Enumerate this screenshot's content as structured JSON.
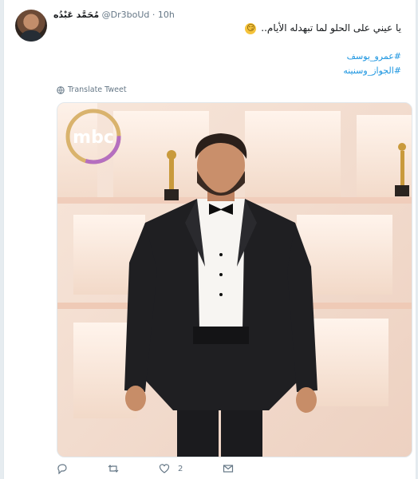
{
  "tweet": {
    "display_name": "مُحَمَّد عَبْدُه",
    "handle": "@Dr3boUd",
    "separator": "·",
    "time": "10h",
    "text": "يا عيني على الحلو لما تبهدله الأيام..",
    "emoji": "😏",
    "hashtags": [
      "#عمرو_يوسف",
      "#الجواز_وسنينه"
    ],
    "translate_label": "Translate Tweet"
  },
  "media": {
    "logo_text": "mbc",
    "description_colors": {
      "backdrop": "#f2dccf",
      "suit": "#1f1f22",
      "shirt": "#f7f5f2"
    }
  },
  "actions": {
    "reply_icon": "reply-icon",
    "retweet_icon": "retweet-icon",
    "like_icon": "heart-icon",
    "like_count": "2",
    "dm_icon": "envelope-icon"
  },
  "colors": {
    "accent": "#1b95e0",
    "muted": "#657786",
    "text": "#14171a"
  }
}
